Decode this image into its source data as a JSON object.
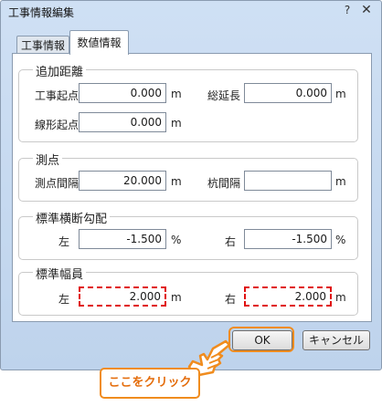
{
  "window": {
    "title": "工事情報編集",
    "help_glyph": "?",
    "close_glyph": "✕"
  },
  "tabs": [
    {
      "label": "工事情報",
      "active": false
    },
    {
      "label": "数値情報",
      "active": true
    }
  ],
  "groups": {
    "distance": {
      "title": "追加距離",
      "start_label": "工事起点",
      "start_value": "0.000",
      "start_unit": "m",
      "total_label": "総延長",
      "total_value": "0.000",
      "total_unit": "m",
      "alignment_label": "線形起点",
      "alignment_value": "0.000",
      "alignment_unit": "m"
    },
    "station": {
      "title": "測点",
      "interval_label": "測点間隔",
      "interval_value": "20.000",
      "interval_unit": "m",
      "stake_label": "杭間隔",
      "stake_value": "",
      "stake_unit": "m"
    },
    "slope": {
      "title": "標準横断勾配",
      "left_label": "左",
      "left_value": "-1.500",
      "left_unit": "%",
      "right_label": "右",
      "right_value": "-1.500",
      "right_unit": "%"
    },
    "width": {
      "title": "標準幅員",
      "left_label": "左",
      "left_value": "2.000",
      "left_unit": "m",
      "right_label": "右",
      "right_value": "2.000",
      "right_unit": "m"
    }
  },
  "buttons": {
    "ok": "OK",
    "cancel": "キャンセル"
  },
  "callout": {
    "text": "ここをクリック"
  },
  "colors": {
    "highlight_red": "#e01010",
    "callout_orange": "#f08c1e",
    "dialog_bg": "#c6d9f0"
  }
}
